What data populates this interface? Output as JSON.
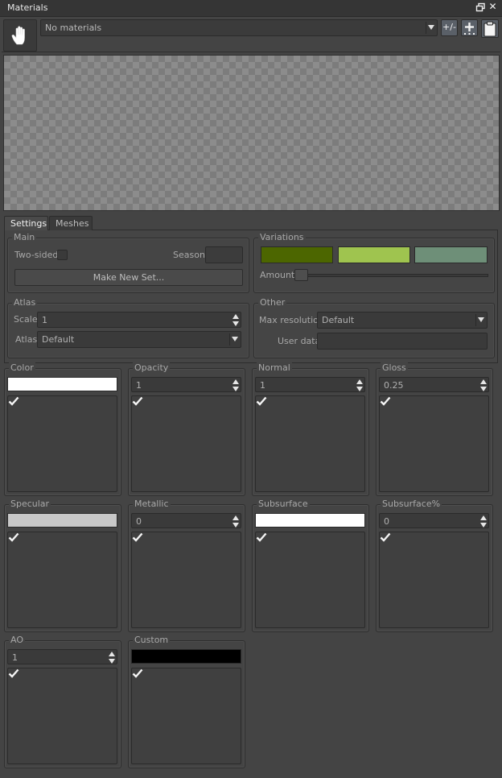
{
  "window": {
    "title": "Materials"
  },
  "toolbar": {
    "material_select_value": "No materials",
    "plusminus_label": "+/-"
  },
  "tabs": [
    {
      "label": "Settings",
      "active": true
    },
    {
      "label": "Meshes",
      "active": false
    }
  ],
  "settings": {
    "main": {
      "group_label": "Main",
      "two_sided_label": "Two-sided",
      "season_label": "Season",
      "make_new_set_label": "Make New Set..."
    },
    "variations": {
      "group_label": "Variations",
      "colors": [
        "#4c6600",
        "#9fc44f",
        "#6e8f78"
      ],
      "amount_label": "Amount"
    },
    "atlas": {
      "group_label": "Atlas",
      "scale_label": "Scale",
      "scale_value": "1",
      "atlas_label": "Atlas",
      "atlas_value": "Default"
    },
    "other": {
      "group_label": "Other",
      "max_resolution_label": "Max resolution",
      "max_resolution_value": "Default",
      "user_data_label": "User data",
      "user_data_value": ""
    }
  },
  "channels": [
    {
      "label": "Color",
      "kind": "swatch",
      "color": "#ffffff",
      "checked": true
    },
    {
      "label": "Opacity",
      "kind": "number",
      "value": "1",
      "checked": true
    },
    {
      "label": "Normal",
      "kind": "number",
      "value": "1",
      "checked": true
    },
    {
      "label": "Gloss",
      "kind": "number",
      "value": "0.25",
      "checked": true
    },
    {
      "label": "Specular",
      "kind": "swatch",
      "color": "#c8c8c8",
      "checked": true
    },
    {
      "label": "Metallic",
      "kind": "number",
      "value": "0",
      "checked": true
    },
    {
      "label": "Subsurface",
      "kind": "swatch",
      "color": "#ffffff",
      "checked": true
    },
    {
      "label": "Subsurface%",
      "kind": "number",
      "value": "0",
      "checked": true
    },
    {
      "label": "AO",
      "kind": "number",
      "value": "1",
      "checked": true
    },
    {
      "label": "Custom",
      "kind": "swatch",
      "color": "#000000",
      "checked": true
    }
  ]
}
